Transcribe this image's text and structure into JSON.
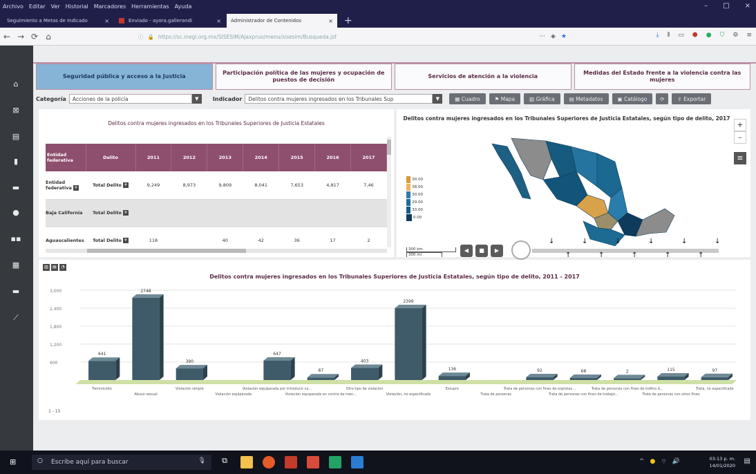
{
  "browser": {
    "menu": [
      "Archivo",
      "Editar",
      "Ver",
      "Historial",
      "Marcadores",
      "Herramientas",
      "Ayuda"
    ],
    "tabs": [
      {
        "label": "Seguimiento a Metas de Indicado"
      },
      {
        "label": "Enviado - ayora.gallerandi"
      },
      {
        "label": "Administrador de Contenidos"
      }
    ],
    "url": "https://sc.inegi.org.mx/SISESIM/Ajaxpruo/menu/sisesim/Busqueda.jsf",
    "url_domain": "inegi.org.mx",
    "address_actions": "···"
  },
  "category_tabs": [
    {
      "label": "Seguridad pública y acceso a la Justicia"
    },
    {
      "label": "Participación política de las mujeres y ocupación de puestos de decisión"
    },
    {
      "label": "Servicios de atención a la violencia"
    },
    {
      "label": "Medidas del Estado frente a la violencia contra las mujeres"
    }
  ],
  "filters": {
    "categoria_label": "Categoría",
    "categoria_value": "Acciones de la policía",
    "indicador_label": "Indicador",
    "indicador_value": "Delitos contra mujeres ingresados en los Tribunales Sup",
    "buttons": [
      "Cuadro",
      "Mapa",
      "Gráfica",
      "Metadatos",
      "Catálogo",
      "Exportar"
    ]
  },
  "table_panel": {
    "title": "Delitos contra mujeres ingresados en los Tribunales Superiores de Justicia Estatales",
    "columns": [
      "Entidad federativa",
      "Delito",
      "2011",
      "2012",
      "2013",
      "2014",
      "2015",
      "2016",
      "2017"
    ],
    "rows": [
      {
        "entity": "Entidad federativa",
        "crime": "Total Delito",
        "values": [
          "9,249",
          "8,973",
          "9,809",
          "8,041",
          "7,653",
          "4,817",
          "7,46"
        ]
      },
      {
        "entity": "Baja California",
        "crime": "Total Delito",
        "values": [
          "",
          "",
          "",
          "",
          "",
          "",
          ""
        ]
      },
      {
        "entity": "Aguascalientes",
        "crime": "Total Delito",
        "values": [
          "118",
          "",
          "40",
          "42",
          "36",
          "17",
          "2"
        ]
      }
    ]
  },
  "map_panel": {
    "title": "Delitos contra mujeres ingresados en los Tribunales Superiores de Justicia Estatales, según tipo de delito, 2017",
    "legend": [
      "30.00",
      "38.00",
      "30.00",
      "29.00",
      "33.00",
      "0.00"
    ],
    "legend_colors": [
      "#d49a3a",
      "#f0b35a",
      "#2f7aa6",
      "#1f6d96",
      "#155d85",
      "#0e3a5c"
    ],
    "scale_top": "300 km",
    "scale_bottom": "300 mi",
    "zoom_in": "+",
    "zoom_out": "–"
  },
  "chart_data": {
    "type": "bar",
    "title": "Delitos contra mujeres ingresados en los Tribunales Superiores de Justicia Estatales, según tipo de delito, 2011 - 2017",
    "categories": [
      "Feminicidio",
      "Abuso sexual",
      "Violación simple",
      "Violación equiparada",
      "Violación equiparada por introducir ca...",
      "Violación equiparada en contra de men...",
      "Otro tipo de violación",
      "Violación, no especificado",
      "Estupro",
      "Trata de personas",
      "Trata de personas con fines de explotac...",
      "Trata de personas con fines de trabajo...",
      "Trata de personas con fines de tráfico d...",
      "Trata de personas con otros fines",
      "Trata, no especificado"
    ],
    "values": [
      641,
      2748,
      390,
      0,
      647,
      87,
      403,
      2399,
      136,
      0,
      92,
      68,
      2,
      115,
      97
    ],
    "value_labels": [
      "641",
      "2748",
      "390",
      "",
      "647",
      "87",
      "403",
      "2399",
      "136",
      "",
      "92",
      "68",
      "2",
      "115",
      "97"
    ],
    "y_ticks": [
      "3,000",
      "2,400",
      "1,800",
      "1,200",
      "600"
    ],
    "ylim": [
      0,
      3000
    ],
    "grid": true,
    "pager": "1 - 15",
    "bar_color": "#3f5a68"
  },
  "taskbar": {
    "search_placeholder": "Escribe aquí para buscar",
    "time": "03:13 p. m.",
    "date": "14/01/2020"
  }
}
